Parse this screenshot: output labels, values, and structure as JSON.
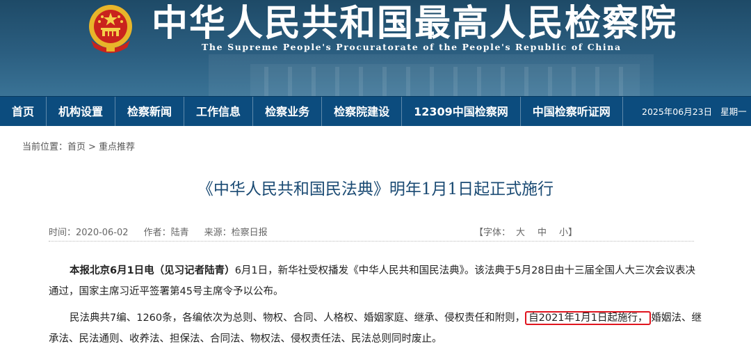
{
  "header": {
    "title": "中华人民共和国最高人民检察院",
    "subtitle": "The Supreme People's Procuratorate of the People's Republic of China",
    "emblem_icon": "national-emblem-icon",
    "bg_color": "#23526f"
  },
  "nav": {
    "items": [
      {
        "label": "首页"
      },
      {
        "label": "机构设置"
      },
      {
        "label": "检察新闻"
      },
      {
        "label": "工作信息"
      },
      {
        "label": "检察业务"
      },
      {
        "label": "检察院建设"
      },
      {
        "label": "12309中国检察网"
      },
      {
        "label": "中国检察听证网"
      }
    ],
    "date": "2025年06月23日",
    "weekday": "星期一",
    "bg_color": "#0c4c7e"
  },
  "breadcrumb": {
    "prefix": "当前位置：",
    "home": "首页",
    "separator": ">",
    "current": "重点推荐"
  },
  "article": {
    "title": "《中华人民共和国民法典》明年1月1日起正式施行",
    "time": "时间：2020-06-02",
    "author": "作者：陆青",
    "source": "来源：检察日报",
    "font_label": "【字体：",
    "font_large": "大",
    "font_medium": "中",
    "font_small": "小",
    "font_end": "】",
    "p1_lead": "本报北京6月1日电（见习记者陆青）",
    "p1_text": "6月1日，新华社受权播发《中华人民共和国民法典》。该法典于5月28日由十三届全国人大三次会议表决通过，国家主席习近平签署第45号主席令予以公布。",
    "p2_before": "民法典共7编、1260条，各编依次为总则、物权、合同、人格权、婚姻家庭、继承、侵权责任和附则，",
    "p2_highlight": "自2021年1月1日起施行，",
    "p2_after": "婚姻法、继承法、民法通则、收养法、担保法、合同法、物权法、侵权责任法、民法总则同时废止。",
    "title_color": "#1a4a73",
    "highlight_color": "#e0141e"
  }
}
